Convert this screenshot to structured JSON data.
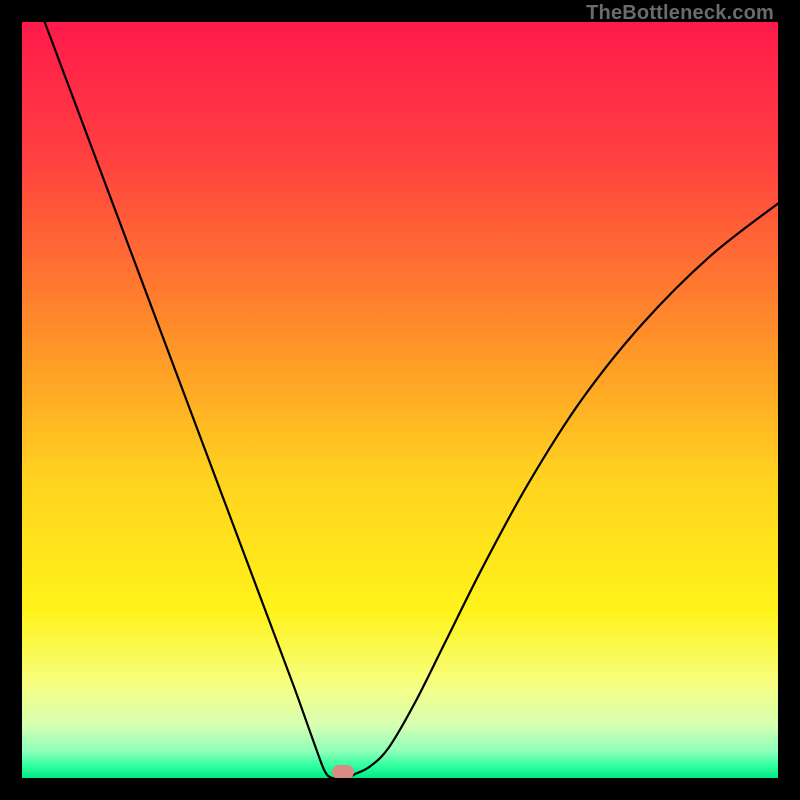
{
  "watermark": "TheBottleneck.com",
  "chart_data": {
    "type": "line",
    "title": "",
    "xlabel": "",
    "ylabel": "",
    "xlim": [
      0,
      100
    ],
    "ylim": [
      0,
      100
    ],
    "series": [
      {
        "name": "bottleneck-curve",
        "x": [
          3,
          6,
          9,
          12,
          15,
          18,
          21,
          24,
          27,
          30,
          33,
          36,
          38.5,
          40,
          41,
          42,
          43,
          44,
          46,
          48.5,
          52,
          56,
          61,
          67,
          74,
          82,
          91,
          100
        ],
        "y": [
          100,
          92,
          84,
          76,
          68,
          60,
          52,
          44,
          36,
          28,
          20,
          12,
          5,
          1,
          0,
          0,
          0,
          0.5,
          1.5,
          4,
          10,
          18,
          28,
          39,
          50,
          60,
          69,
          76
        ]
      }
    ],
    "marker": {
      "x": 42.5,
      "y": 0.8
    },
    "gradient_stops": [
      {
        "offset": 0,
        "color": "#ff1a4b"
      },
      {
        "offset": 0.18,
        "color": "#ff4040"
      },
      {
        "offset": 0.4,
        "color": "#ff8a2a"
      },
      {
        "offset": 0.6,
        "color": "#ffd21f"
      },
      {
        "offset": 0.78,
        "color": "#fff31a"
      },
      {
        "offset": 0.88,
        "color": "#f6ff85"
      },
      {
        "offset": 0.93,
        "color": "#d6ffb3"
      },
      {
        "offset": 0.965,
        "color": "#8dffb9"
      },
      {
        "offset": 0.985,
        "color": "#2aff9e"
      },
      {
        "offset": 1.0,
        "color": "#00e884"
      }
    ]
  }
}
